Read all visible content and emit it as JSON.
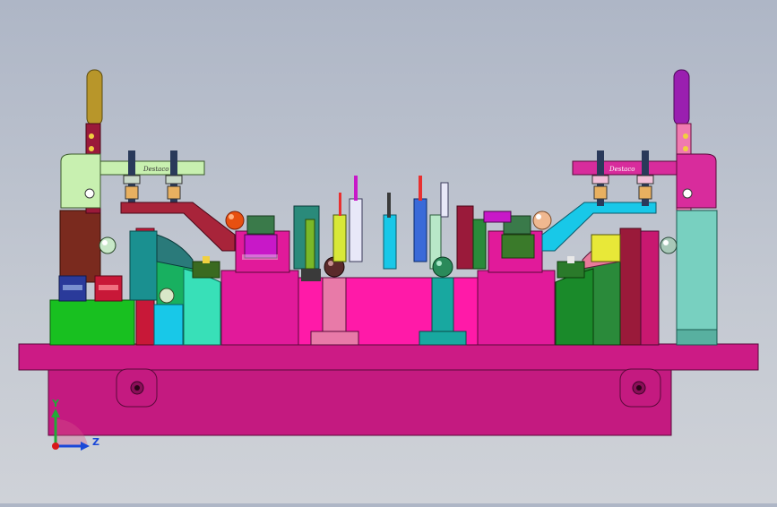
{
  "viewport": {
    "background_top": "#aeb6c6",
    "background_bottom": "#cfd2d8"
  },
  "model": {
    "colors": {
      "base_plate": "#cc1b85",
      "fixture_body": "#e11a9a",
      "clamp_left_handle": "#b8962a",
      "clamp_right_handle": "#9a1fb0",
      "clamp_left_arm": "#c8f0b0",
      "clamp_right_arm": "#d82c9c",
      "rail_left": "#a8243a",
      "rail_right": "#18c8e8",
      "column_left": "#7a2a1e",
      "column_right": "#78d0c0",
      "block_green": "#18c020",
      "cyan_block": "#18c8e8"
    },
    "clamp_left_text": "Destaco",
    "clamp_right_text": "Destaco"
  },
  "triad": {
    "y_label": "Y",
    "z_label": "Z",
    "y_color": "#22a838",
    "z_color": "#1a48d8",
    "x_color": "#d81818"
  }
}
